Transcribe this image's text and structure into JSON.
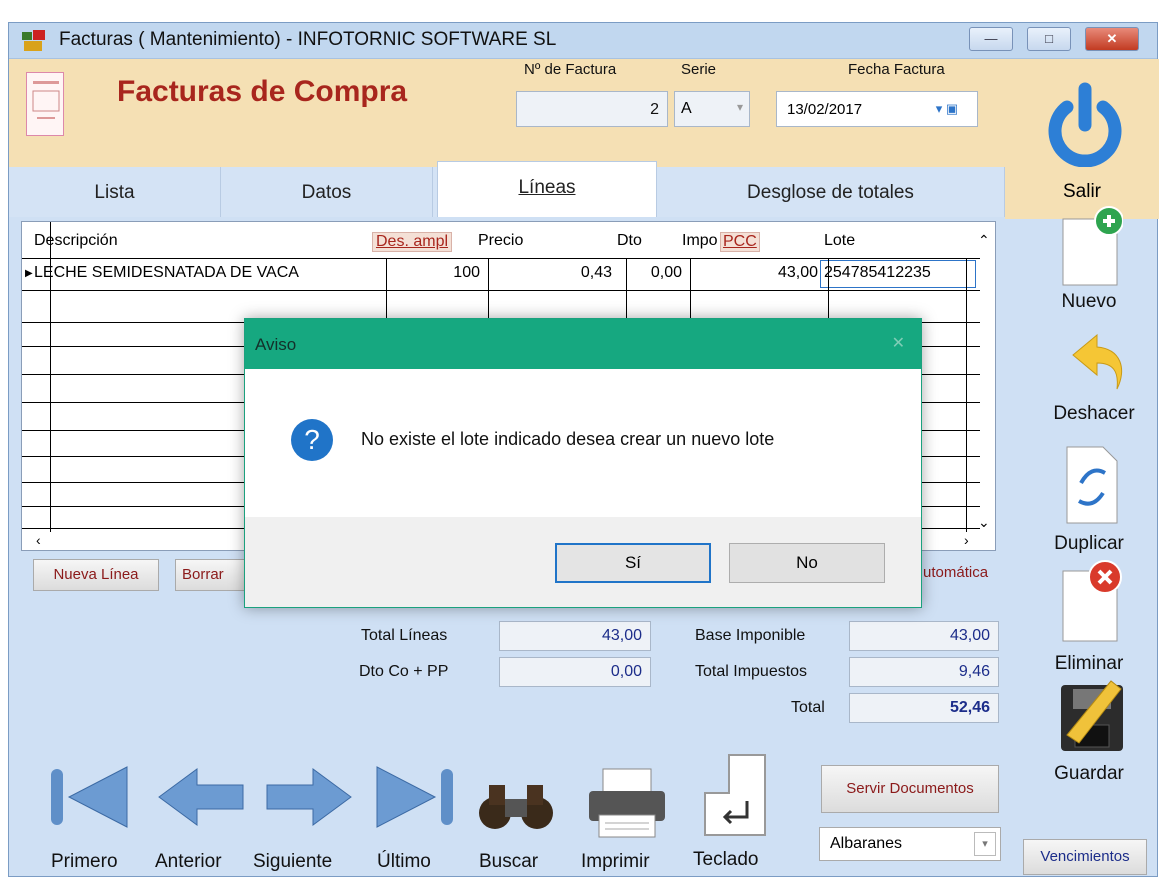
{
  "window": {
    "title": "Facturas ( Mantenimiento) - INFOTORNIC SOFTWARE SL",
    "minimize": "—",
    "maximize": "□",
    "close": "✕"
  },
  "header": {
    "title": "Facturas de Compra",
    "invoice_no_label": "Nº de Factura",
    "invoice_no": "2",
    "serie_label": "Serie",
    "serie": "A",
    "date_label": "Fecha Factura",
    "date": "13/02/2017"
  },
  "tabs": [
    "Lista",
    "Datos",
    "Líneas",
    "Desglose de totales"
  ],
  "active_tab": "Líneas",
  "grid": {
    "columns": [
      "Descripción",
      "Des. ampl",
      "Precio",
      "Dto",
      "Impo",
      "PCC",
      "Lote"
    ],
    "rows": [
      {
        "descripcion": "LECHE SEMIDESNATADA DE VACA",
        "des_ampl": "100",
        "precio": "0,43",
        "dto": "0,00",
        "importe": "43,00",
        "lote": "254785412235"
      }
    ]
  },
  "line_buttons": {
    "new_line": "Nueva Línea",
    "delete": "Borrar",
    "auto_fragment": "utomática"
  },
  "totals": {
    "total_lineas_label": "Total Líneas",
    "total_lineas": "43,00",
    "dto_label": "Dto Co + PP",
    "dto": "0,00",
    "base_label": "Base Imponible",
    "base": "43,00",
    "impuestos_label": "Total Impuestos",
    "impuestos": "9,46",
    "total_label": "Total",
    "total": "52,46"
  },
  "right_panel": {
    "exit": "Salir",
    "new": "Nuevo",
    "undo": "Deshacer",
    "duplicate": "Duplicar",
    "delete": "Eliminar",
    "save": "Guardar",
    "vencimientos": "Vencimientos"
  },
  "nav": {
    "first": "Primero",
    "previous": "Anterior",
    "next": "Siguiente",
    "last": "Último",
    "search": "Buscar",
    "print": "Imprimir",
    "keyboard": "Teclado",
    "serve_docs": "Servir Documentos",
    "doc_type": "Albaranes"
  },
  "dialog": {
    "title": "Aviso",
    "message": "No existe el lote indicado desea crear un nuevo lote",
    "yes": "Sí",
    "no": "No"
  },
  "colors": {
    "dialog_header": "#16a880",
    "header_bg": "#f5e0b4",
    "title_red": "#a8261d",
    "panel_bg": "#cfe0f4"
  }
}
